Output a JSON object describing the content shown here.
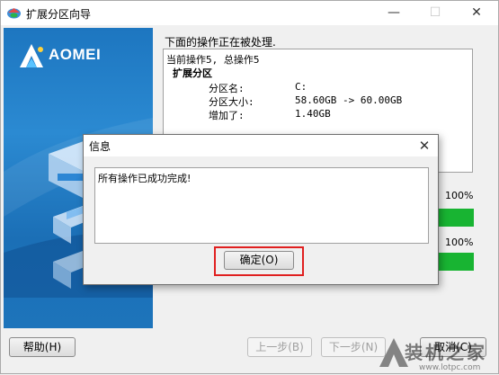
{
  "window": {
    "title": "扩展分区向导",
    "brand": "AOMEI"
  },
  "instruction": "下面的操作正在被处理.",
  "log": {
    "line1": "当前操作5, 总操作5",
    "heading": "扩展分区",
    "rows": [
      {
        "label": "分区名:",
        "value": "C:"
      },
      {
        "label": "分区大小:",
        "value": "58.60GB -> 60.00GB"
      },
      {
        "label": "增加了:",
        "value": "1.40GB"
      }
    ]
  },
  "progress": {
    "bar1_label": "100%",
    "bar1_value": 1.0,
    "bar2_label": "100%",
    "bar2_value": 1.0
  },
  "buttons": {
    "help": "帮助(H)",
    "back": "上一步(B)",
    "next": "下一步(N)",
    "cancel": "取消(C)"
  },
  "dialog": {
    "title": "信息",
    "message": "所有操作已成功完成!",
    "ok": "确定(O)"
  },
  "watermark": {
    "name": "装机之家",
    "url": "www.lotpc.com"
  },
  "colors": {
    "accent": "#1d76c0",
    "progress": "#18b432",
    "highlight": "#e02020"
  }
}
